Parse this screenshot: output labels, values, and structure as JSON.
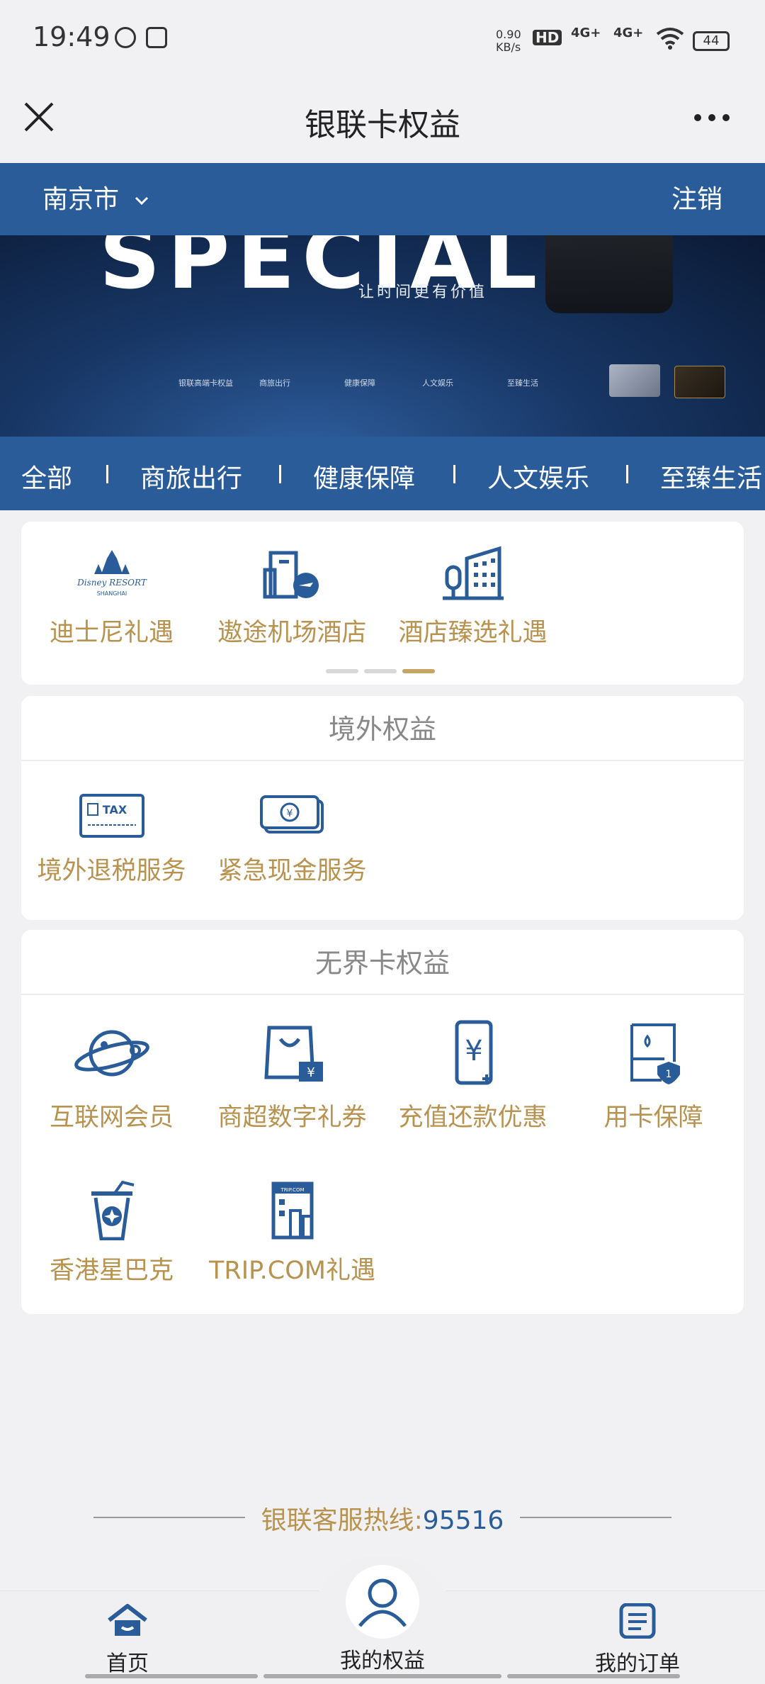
{
  "status_bar": {
    "time": "19:49",
    "net_speed": "0.90",
    "net_unit": "KB/s",
    "hd": "HD",
    "sim1": "4G+",
    "sim2": "4G+",
    "battery": "44"
  },
  "nav": {
    "title": "银联卡权益"
  },
  "city_bar": {
    "city": "南京市",
    "logout": "注销"
  },
  "banner": {
    "headline": "SPECIAL",
    "slogan": "让时间更有价值",
    "tags": [
      "银联高端卡权益",
      "商旅出行",
      "健康保障",
      "人文娱乐",
      "至臻生活"
    ]
  },
  "tabs": [
    "全部",
    "商旅出行",
    "健康保障",
    "人文娱乐",
    "至臻生活"
  ],
  "featured": {
    "items": [
      {
        "label": "迪士尼礼遇",
        "icon": "disney-resort-icon"
      },
      {
        "label": "遨途机场酒店",
        "icon": "airport-hotel-icon"
      },
      {
        "label": "酒店臻选礼遇",
        "icon": "hotel-building-icon"
      }
    ]
  },
  "overseas": {
    "title": "境外权益",
    "items": [
      {
        "label": "境外退税服务",
        "icon": "tax-card-icon"
      },
      {
        "label": "紧急现金服务",
        "icon": "cash-icon"
      }
    ]
  },
  "unlimited": {
    "title": "无界卡权益",
    "items": [
      {
        "label": "互联网会员",
        "icon": "planet-icon"
      },
      {
        "label": "商超数字礼券",
        "icon": "shopping-bag-icon"
      },
      {
        "label": "充值还款优惠",
        "icon": "phone-recharge-icon"
      },
      {
        "label": "用卡保障",
        "icon": "card-shield-icon"
      },
      {
        "label": "香港星巴克",
        "icon": "coffee-cup-icon"
      },
      {
        "label": "TRIP.COM礼遇",
        "icon": "trip-building-icon"
      }
    ]
  },
  "hotline": {
    "label": "银联客服热线:",
    "number": "95516"
  },
  "bottom_nav": {
    "items": [
      {
        "label": "首页",
        "icon": "home-icon"
      },
      {
        "label": "我的权益",
        "icon": "user-icon"
      },
      {
        "label": "我的订单",
        "icon": "order-list-icon"
      }
    ]
  },
  "colors": {
    "primary": "#2a5c9a",
    "gold": "#b8924f",
    "background": "#f1f1f3"
  }
}
